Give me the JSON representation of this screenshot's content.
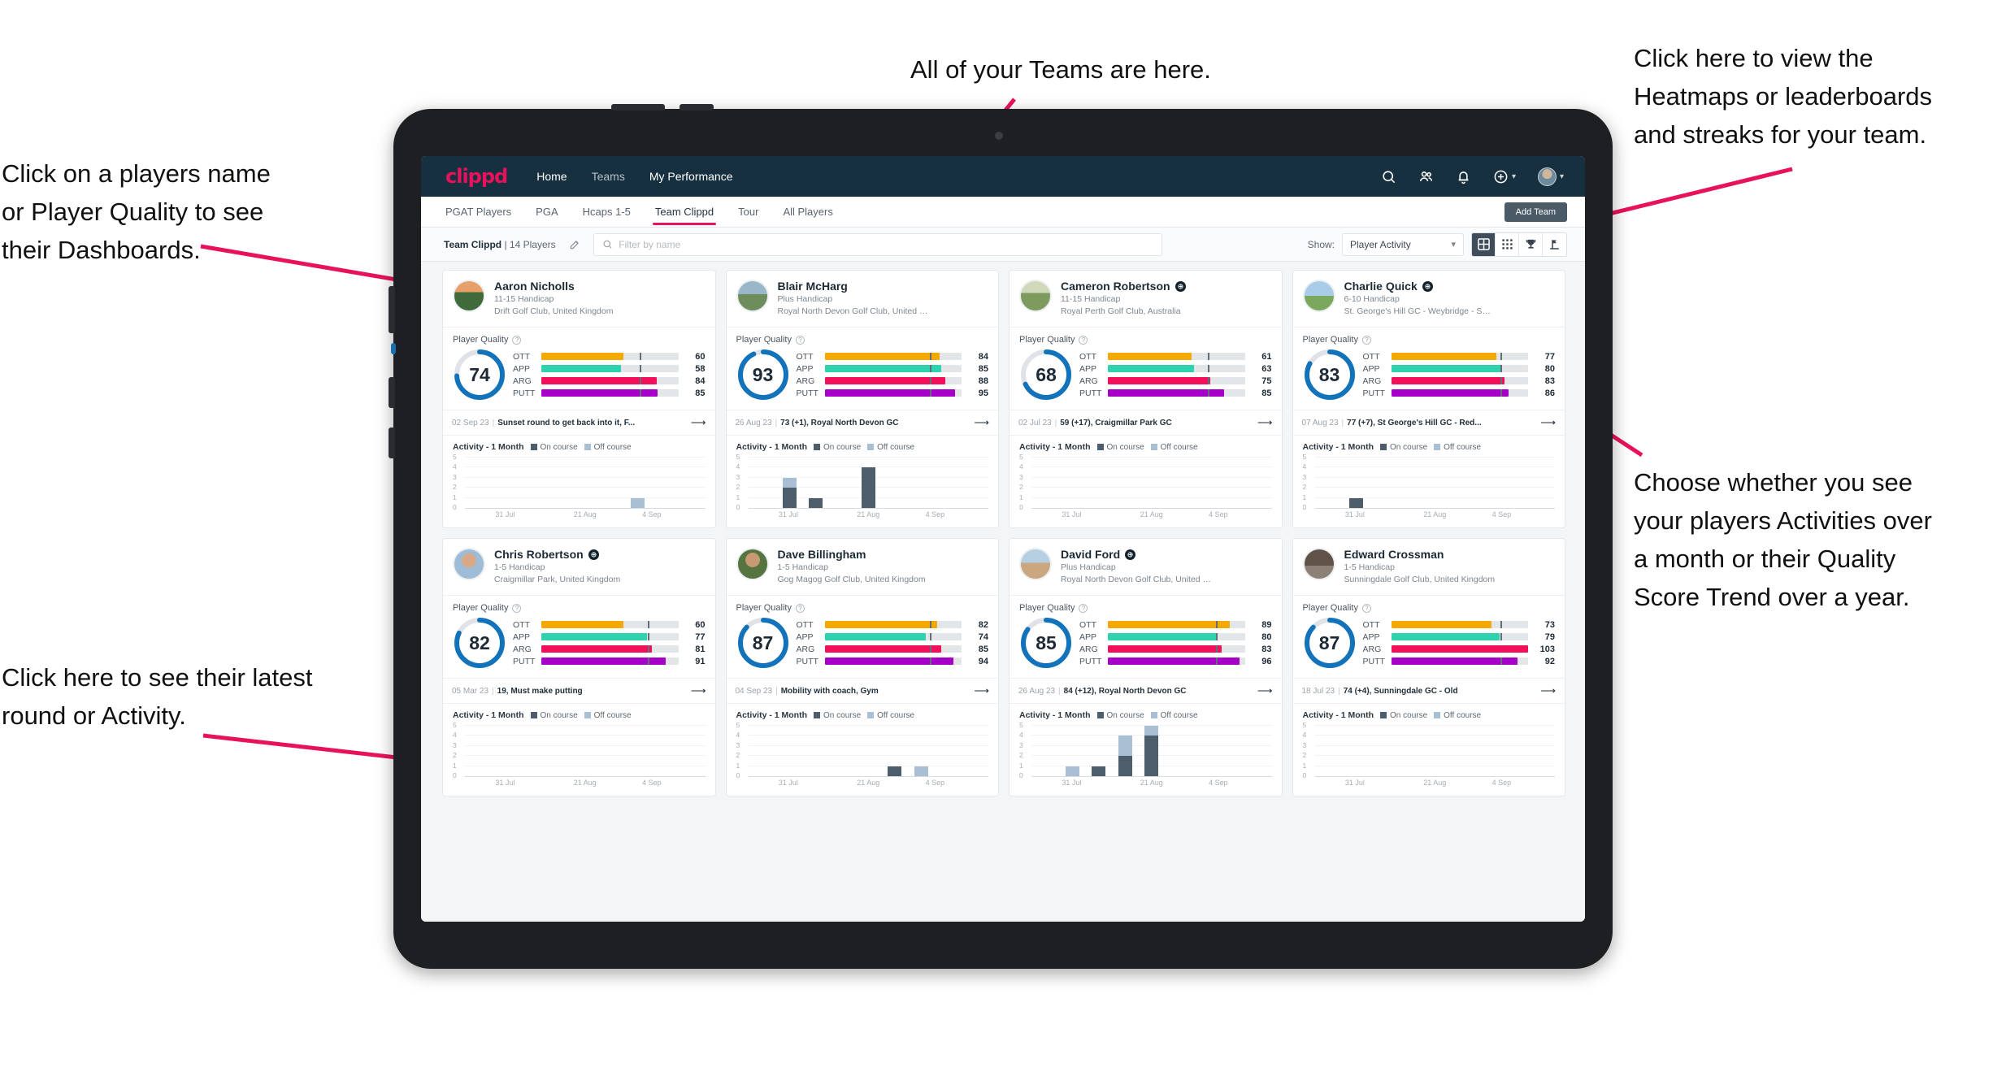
{
  "annotations": {
    "top_left": "Click on a players name\nor Player Quality to see\ntheir Dashboards.",
    "top_center": "All of your Teams are here.",
    "top_right": "Click here to view the\nHeatmaps or leaderboards\nand streaks for your team.",
    "right_middle": "Choose whether you see\nyour players Activities over\na month or their Quality\nScore Trend over a year.",
    "bottom_left": "Click here to see their latest\nround or Activity."
  },
  "topnav": {
    "logo": "clippd",
    "links": [
      {
        "label": "Home",
        "active": true
      },
      {
        "label": "Teams",
        "active": false
      },
      {
        "label": "My Performance",
        "active": true
      }
    ],
    "icons": [
      "search-icon",
      "people-icon",
      "bell-icon",
      "plus-circle-icon",
      "avatar"
    ]
  },
  "subnav": {
    "tabs": [
      {
        "label": "PGAT Players",
        "active": false
      },
      {
        "label": "PGA",
        "active": false
      },
      {
        "label": "Hcaps 1-5",
        "active": false
      },
      {
        "label": "Team Clippd",
        "active": true
      },
      {
        "label": "Tour",
        "active": false
      },
      {
        "label": "All Players",
        "active": false
      }
    ],
    "add_team_label": "Add Team"
  },
  "filterbar": {
    "team_name": "Team Clippd",
    "team_count": "| 14 Players",
    "edit_icon": "pencil-icon",
    "search_placeholder": "Filter by name",
    "search_value": "",
    "show_label": "Show:",
    "show_value": "Player Activity",
    "show_options": [
      "Player Activity",
      "Quality Score Trend"
    ],
    "views": [
      {
        "name": "large-grid-view",
        "active": true
      },
      {
        "name": "small-grid-view",
        "active": false
      },
      {
        "name": "leaderboard-trophy-view",
        "active": false
      },
      {
        "name": "heatmap-flag-view",
        "active": false
      }
    ]
  },
  "card_labels": {
    "player_quality": "Player Quality",
    "activity_title": "Activity - 1 Month",
    "legend_on": "On course",
    "legend_off": "Off course",
    "metric_names": [
      "OTT",
      "APP",
      "ARG",
      "PUTT"
    ]
  },
  "colors": {
    "brand_pink": "#e8125c",
    "nav_dark": "#17303f",
    "ring_blue": "#1273ba",
    "ott": "#f5a800",
    "app": "#2fd2af",
    "arg": "#f2105a",
    "putt": "#a600c8",
    "on_course": "#4e5d6b",
    "off_course": "#a9c0d4"
  },
  "chart_data": {
    "type": "bar",
    "title": "Activity - 1 Month",
    "stacked": true,
    "categories": [
      "31 Jul",
      "21 Aug",
      "4 Sep"
    ],
    "ylim": [
      0,
      5
    ],
    "yticks": [
      0,
      1,
      2,
      3,
      4,
      5
    ],
    "series_names": [
      "On course",
      "Off course"
    ],
    "legend": "top",
    "grid": true,
    "slots": 9
  },
  "players": [
    {
      "name": "Aaron Nicholls",
      "verified": false,
      "handicap": "11-15 Handicap",
      "club": "Drift Golf Club, United Kingdom",
      "quality": 74,
      "metrics": [
        {
          "key": "OTT",
          "value": 60,
          "marker": 72
        },
        {
          "key": "APP",
          "value": 58,
          "marker": 72
        },
        {
          "key": "ARG",
          "value": 84,
          "marker": 72
        },
        {
          "key": "PUTT",
          "value": 85,
          "marker": 72
        }
      ],
      "round": {
        "date": "02 Sep 23",
        "text": "Sunset round to get back into it, F..."
      },
      "activity": {
        "on": [
          0,
          0,
          0,
          0,
          0,
          0,
          0,
          0,
          0
        ],
        "off": [
          0,
          0,
          0,
          0,
          0,
          0,
          1,
          0,
          0
        ]
      }
    },
    {
      "name": "Blair McHarg",
      "verified": false,
      "handicap": "Plus Handicap",
      "club": "Royal North Devon Golf Club, United Kin...",
      "quality": 93,
      "metrics": [
        {
          "key": "OTT",
          "value": 84,
          "marker": 77
        },
        {
          "key": "APP",
          "value": 85,
          "marker": 77
        },
        {
          "key": "ARG",
          "value": 88,
          "marker": 77
        },
        {
          "key": "PUTT",
          "value": 95,
          "marker": 77
        }
      ],
      "round": {
        "date": "26 Aug 23",
        "text": "73 (+1), Royal North Devon GC"
      },
      "activity": {
        "on": [
          0,
          2,
          1,
          0,
          4,
          0,
          0,
          0,
          0
        ],
        "off": [
          0,
          1,
          0,
          0,
          0,
          0,
          0,
          0,
          0
        ]
      }
    },
    {
      "name": "Cameron Robertson",
      "verified": true,
      "handicap": "11-15 Handicap",
      "club": "Royal Perth Golf Club, Australia",
      "quality": 68,
      "metrics": [
        {
          "key": "OTT",
          "value": 61,
          "marker": 73
        },
        {
          "key": "APP",
          "value": 63,
          "marker": 73
        },
        {
          "key": "ARG",
          "value": 75,
          "marker": 73
        },
        {
          "key": "PUTT",
          "value": 85,
          "marker": 73
        }
      ],
      "round": {
        "date": "02 Jul 23",
        "text": "59 (+17), Craigmillar Park GC"
      },
      "activity": {
        "on": [
          0,
          0,
          0,
          0,
          0,
          0,
          0,
          0,
          0
        ],
        "off": [
          0,
          0,
          0,
          0,
          0,
          0,
          0,
          0,
          0
        ]
      }
    },
    {
      "name": "Charlie Quick",
      "verified": true,
      "handicap": "6-10 Handicap",
      "club": "St. George's Hill GC - Weybridge - Surrey, ...",
      "quality": 83,
      "metrics": [
        {
          "key": "OTT",
          "value": 77,
          "marker": 80
        },
        {
          "key": "APP",
          "value": 80,
          "marker": 80
        },
        {
          "key": "ARG",
          "value": 83,
          "marker": 80
        },
        {
          "key": "PUTT",
          "value": 86,
          "marker": 80
        }
      ],
      "round": {
        "date": "07 Aug 23",
        "text": "77 (+7), St George's Hill GC - Red..."
      },
      "activity": {
        "on": [
          0,
          1,
          0,
          0,
          0,
          0,
          0,
          0,
          0
        ],
        "off": [
          0,
          0,
          0,
          0,
          0,
          0,
          0,
          0,
          0
        ]
      }
    },
    {
      "name": "Chris Robertson",
      "verified": true,
      "handicap": "1-5 Handicap",
      "club": "Craigmillar Park, United Kingdom",
      "quality": 82,
      "metrics": [
        {
          "key": "OTT",
          "value": 60,
          "marker": 78
        },
        {
          "key": "APP",
          "value": 77,
          "marker": 78
        },
        {
          "key": "ARG",
          "value": 81,
          "marker": 78
        },
        {
          "key": "PUTT",
          "value": 91,
          "marker": 78
        }
      ],
      "round": {
        "date": "05 Mar 23",
        "text": "19, Must make putting"
      },
      "activity": {
        "on": [
          0,
          0,
          0,
          0,
          0,
          0,
          0,
          0,
          0
        ],
        "off": [
          0,
          0,
          0,
          0,
          0,
          0,
          0,
          0,
          0
        ]
      }
    },
    {
      "name": "Dave Billingham",
      "verified": false,
      "handicap": "1-5 Handicap",
      "club": "Gog Magog Golf Club, United Kingdom",
      "quality": 87,
      "metrics": [
        {
          "key": "OTT",
          "value": 82,
          "marker": 77
        },
        {
          "key": "APP",
          "value": 74,
          "marker": 77
        },
        {
          "key": "ARG",
          "value": 85,
          "marker": 77
        },
        {
          "key": "PUTT",
          "value": 94,
          "marker": 77
        }
      ],
      "round": {
        "date": "04 Sep 23",
        "text": "Mobility with coach, Gym"
      },
      "activity": {
        "on": [
          0,
          0,
          0,
          0,
          0,
          1,
          0,
          0,
          0
        ],
        "off": [
          0,
          0,
          0,
          0,
          0,
          0,
          1,
          0,
          0
        ]
      }
    },
    {
      "name": "David Ford",
      "verified": true,
      "handicap": "Plus Handicap",
      "club": "Royal North Devon Golf Club, United Kin...",
      "quality": 85,
      "metrics": [
        {
          "key": "OTT",
          "value": 89,
          "marker": 79
        },
        {
          "key": "APP",
          "value": 80,
          "marker": 79
        },
        {
          "key": "ARG",
          "value": 83,
          "marker": 79
        },
        {
          "key": "PUTT",
          "value": 96,
          "marker": 79
        }
      ],
      "round": {
        "date": "26 Aug 23",
        "text": "84 (+12), Royal North Devon GC"
      },
      "activity": {
        "on": [
          0,
          0,
          1,
          2,
          4,
          0,
          0,
          0,
          0
        ],
        "off": [
          0,
          1,
          0,
          2,
          1,
          0,
          0,
          0,
          0
        ]
      }
    },
    {
      "name": "Edward Crossman",
      "verified": false,
      "handicap": "1-5 Handicap",
      "club": "Sunningdale Golf Club, United Kingdom",
      "quality": 87,
      "metrics": [
        {
          "key": "OTT",
          "value": 73,
          "marker": 80
        },
        {
          "key": "APP",
          "value": 79,
          "marker": 80
        },
        {
          "key": "ARG",
          "value": 103,
          "marker": null
        },
        {
          "key": "PUTT",
          "value": 92,
          "marker": 80
        }
      ],
      "round": {
        "date": "18 Jul 23",
        "text": "74 (+4), Sunningdale GC - Old"
      },
      "activity": {
        "on": [
          0,
          0,
          0,
          0,
          0,
          0,
          0,
          0,
          0
        ],
        "off": [
          0,
          0,
          0,
          0,
          0,
          0,
          0,
          0,
          0
        ]
      }
    }
  ]
}
